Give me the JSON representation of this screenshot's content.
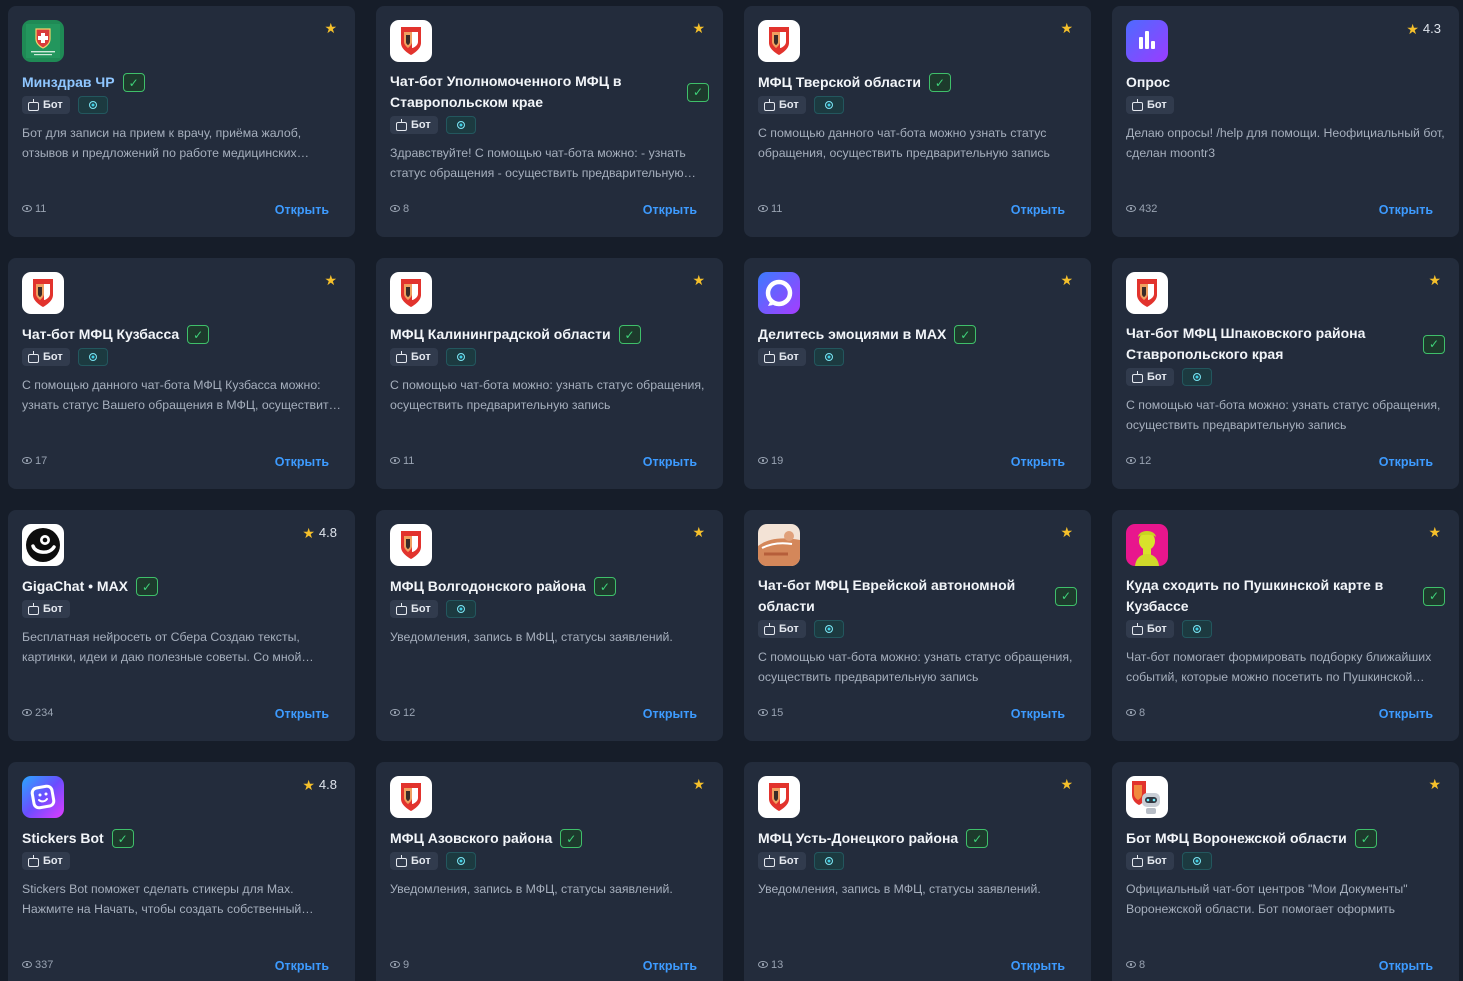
{
  "labels": {
    "bot_tag": "Бот",
    "open": "Открыть"
  },
  "colors": {
    "background": "#161d29",
    "card": "#232c3c",
    "link": "#3d9bff",
    "star": "#f5c02b",
    "verified": "#3fd27a"
  },
  "cards": [
    {
      "title": "Минздрав ЧР",
      "logo": "minzdrav-emblem-icon",
      "rating": "",
      "verified": true,
      "web_tag": true,
      "description": "Бот для записи на прием к врачу, приёма жалоб, отзывов и предложений по работе медицинских учреждений",
      "views": "11"
    },
    {
      "title": "Чат-бот Уполномоченного МФЦ в Ставропольском крае",
      "logo": "mfc-logo-icon",
      "rating": "",
      "verified": true,
      "web_tag": true,
      "description": "Здравствуйте! С помощью чат-бота можно: - узнать статус обращения - осуществить предварительную запись",
      "views": "8"
    },
    {
      "title": "МФЦ Тверской области",
      "logo": "mfc-logo-icon",
      "rating": "",
      "verified": true,
      "web_tag": true,
      "description": "С помощью данного чат-бота можно узнать статус обращения, осуществить предварительную запись",
      "views": "11"
    },
    {
      "title": "Опрос",
      "logo": "poll-chart-icon",
      "rating": "4.3",
      "verified": false,
      "web_tag": false,
      "description": "Делаю опросы! /help для помощи. Неофициальный бот, сделан moontr3",
      "views": "432"
    },
    {
      "title": "Чат-бот МФЦ Кузбасса",
      "logo": "mfc-logo-icon",
      "rating": "",
      "verified": true,
      "web_tag": true,
      "description": "С помощью данного чат-бота МФЦ Кузбасса можно: узнать статус Вашего обращения в МФЦ, осуществить запись",
      "views": "17"
    },
    {
      "title": "МФЦ Калининградской области",
      "logo": "mfc-logo-icon",
      "rating": "",
      "verified": true,
      "web_tag": true,
      "description": "С помощью чат-бота можно: узнать статус обращения, осуществить предварительную запись",
      "views": "11"
    },
    {
      "title": "Делитесь эмоциями в MAX",
      "logo": "max-messenger-icon",
      "rating": "",
      "verified": true,
      "web_tag": true,
      "description": "",
      "views": "19"
    },
    {
      "title": "Чат-бот МФЦ Шпаковского района Ставропольского края",
      "logo": "mfc-logo-icon",
      "rating": "",
      "verified": true,
      "web_tag": true,
      "description": "С помощью чат-бота можно: узнать статус обращения, осуществить предварительную запись",
      "views": "12"
    },
    {
      "title": "GigaChat • MAX",
      "logo": "gigachat-icon",
      "rating": "4.8",
      "verified": true,
      "web_tag": false,
      "description": "Бесплатная нейросеть от Сбера Создаю тексты, картинки, идеи и даю полезные советы. Со мной можно",
      "views": "234"
    },
    {
      "title": "МФЦ Волгодонского района",
      "logo": "mfc-logo-icon",
      "rating": "",
      "verified": true,
      "web_tag": true,
      "description": "Уведомления, запись в МФЦ, статусы заявлений.",
      "views": "12"
    },
    {
      "title": "Чат-бот МФЦ Еврейской автономной области",
      "logo": "mfc-photo-icon",
      "rating": "",
      "verified": true,
      "web_tag": true,
      "description": "С помощью чат-бота можно: узнать статус обращения, осуществить предварительную запись",
      "views": "15"
    },
    {
      "title": "Куда сходить по Пушкинской карте в Кузбассе",
      "logo": "pushkin-portrait-icon",
      "rating": "",
      "verified": true,
      "web_tag": true,
      "description": "Чат-бот помогает формировать подборку ближайших событий, которые можно посетить по Пушкинской карте",
      "views": "8"
    },
    {
      "title": "Stickers Bot",
      "logo": "stickers-bot-icon",
      "rating": "4.8",
      "verified": true,
      "web_tag": false,
      "description": "Stickers Bot поможет сделать стикеры для Max. Нажмите на Начать, чтобы создать собственный стикерпак",
      "views": "337"
    },
    {
      "title": "МФЦ Азовского района",
      "logo": "mfc-logo-icon",
      "rating": "",
      "verified": true,
      "web_tag": true,
      "description": "Уведомления, запись в МФЦ, статусы заявлений.",
      "views": "9"
    },
    {
      "title": "МФЦ Усть-Донецкого района",
      "logo": "mfc-logo-icon",
      "rating": "",
      "verified": true,
      "web_tag": true,
      "description": "Уведомления, запись в МФЦ, статусы заявлений.",
      "views": "13"
    },
    {
      "title": "Бот МФЦ Воронежской области",
      "logo": "mfc-robot-icon",
      "rating": "",
      "verified": true,
      "web_tag": true,
      "description": "Официальный чат-бот центров \"Мои Документы\" Воронежской области. Бот помогает оформить",
      "views": "8"
    }
  ]
}
